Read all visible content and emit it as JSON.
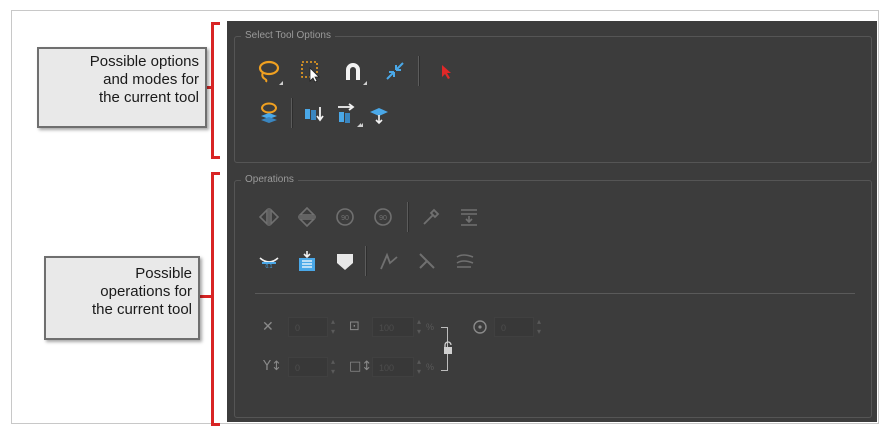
{
  "select_tool_options": {
    "title": "Select Tool Options",
    "row1": [
      {
        "icon": "lasso-icon",
        "has_menu": true
      },
      {
        "icon": "marquee-select-icon",
        "has_menu": false
      },
      {
        "icon": "snap-magnet-icon",
        "has_menu": true
      },
      {
        "icon": "shrink-arrows-icon",
        "has_menu": false
      },
      {
        "icon": "red-arrow-cursor-icon",
        "has_menu": false
      }
    ],
    "row2": [
      {
        "icon": "lasso-layers-icon",
        "has_menu": false
      },
      {
        "icon": "bring-to-front-icon",
        "has_menu": false
      },
      {
        "icon": "send-forward-icon",
        "has_menu": true
      },
      {
        "icon": "flatten-icon",
        "has_menu": true
      }
    ]
  },
  "operations": {
    "title": "Operations",
    "row1": [
      "flip-horizontal-icon",
      "flip-vertical-icon",
      "rotate-cw-90-icon",
      "rotate-ccw-90-icon",
      "eyedropper-icon",
      "distribute-icon"
    ],
    "row2": [
      "smooth-curve-icon",
      "create-matte-icon",
      "arrow-shape-icon",
      "adjust-contour-icon",
      "cut-icon",
      "optimize-icon"
    ],
    "fields": {
      "x": "0",
      "y": "0",
      "width": "100",
      "height": "100",
      "angle": "0",
      "width_unit": "%",
      "height_unit": "%"
    }
  },
  "callouts": {
    "top": [
      "Possible options",
      "and modes for",
      "the current tool"
    ],
    "bottom": [
      "Possible",
      "operations for",
      "the current tool"
    ]
  },
  "colors": {
    "panel_bg": "#3c3c3c",
    "bracket_red": "#d82424",
    "lasso_orange": "#f0a020",
    "tool_blue": "#4aa8e8"
  }
}
